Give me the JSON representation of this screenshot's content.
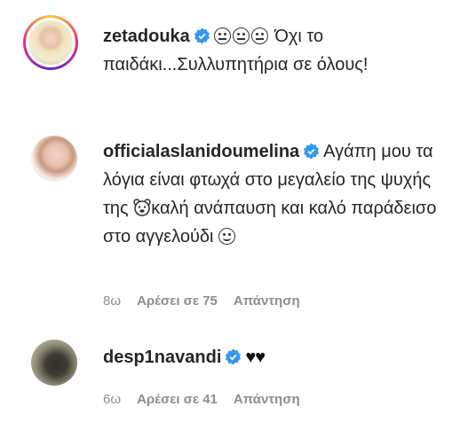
{
  "comments": [
    {
      "username": "zetadouka",
      "text": "Όχι το παιδάκι...Συλλυπητήρια σε όλους!",
      "emojis": [
        "neutral-face",
        "neutral-face",
        "neutral-face"
      ]
    },
    {
      "username": "officialaslanidoumelina",
      "text_part1": "Αγάπη μου τα λόγια είναι φτωχά στο μεγαλείο της ψυχής της",
      "text_part2": "καλή ανάπαυση και καλό παράδεισο στο αγγελούδι",
      "emojis": [
        "bear-face",
        "smiling-face"
      ],
      "time": "8ω",
      "likes": "Αρέσει σε 75",
      "reply": "Απάντηση"
    },
    {
      "username": "desp1navandi",
      "hearts": "♥♥",
      "time": "6ω",
      "likes": "Αρέσει σε 41",
      "reply": "Απάντηση"
    }
  ],
  "colors": {
    "verified": "#3897f0",
    "meta": "#8e8e8e",
    "text": "#262626"
  }
}
